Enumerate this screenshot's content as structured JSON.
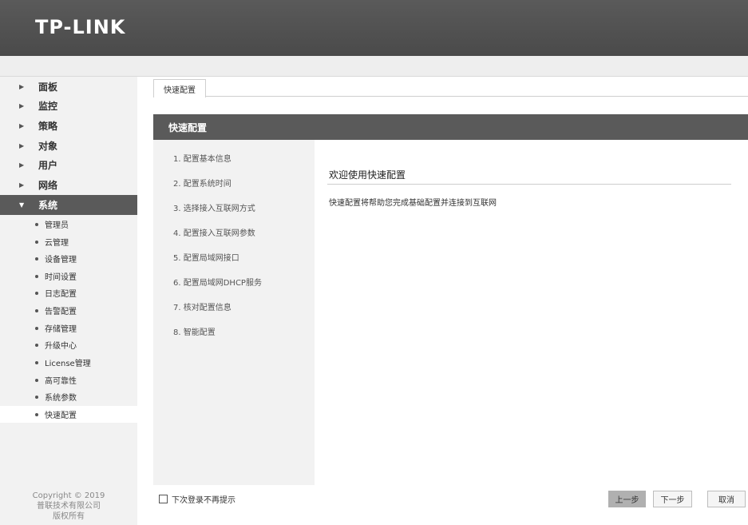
{
  "header": {
    "logo": "TP-LINK"
  },
  "sidebar": {
    "menu": [
      {
        "label": "面板"
      },
      {
        "label": "监控"
      },
      {
        "label": "策略"
      },
      {
        "label": "对象"
      },
      {
        "label": "用户"
      },
      {
        "label": "网络"
      },
      {
        "label": "系统",
        "active": true
      }
    ],
    "submenu": [
      {
        "label": "管理员"
      },
      {
        "label": "云管理"
      },
      {
        "label": "设备管理"
      },
      {
        "label": "时间设置"
      },
      {
        "label": "日志配置"
      },
      {
        "label": "告警配置"
      },
      {
        "label": "存储管理"
      },
      {
        "label": "升级中心"
      },
      {
        "label": "License管理"
      },
      {
        "label": "高可靠性"
      },
      {
        "label": "系统参数"
      },
      {
        "label": "快速配置",
        "selected": true
      }
    ],
    "copyright": [
      "Copyright © 2019",
      "普联技术有限公司",
      "版权所有"
    ]
  },
  "tabs": [
    {
      "label": "快速配置"
    }
  ],
  "panel": {
    "title": "快速配置",
    "steps": [
      "1. 配置基本信息",
      "2. 配置系统时间",
      "3. 选择接入互联网方式",
      "4. 配置接入互联网参数",
      "5. 配置局域网接口",
      "6. 配置局域网DHCP服务",
      "7. 核对配置信息",
      "8. 智能配置"
    ],
    "welcome_title": "欢迎使用快速配置",
    "welcome_desc": "快速配置将帮助您完成基础配置并连接到互联网"
  },
  "footer": {
    "no_prompt_label": "下次登录不再提示",
    "prev_label": "上一步",
    "next_label": "下一步",
    "cancel_label": "取消"
  }
}
